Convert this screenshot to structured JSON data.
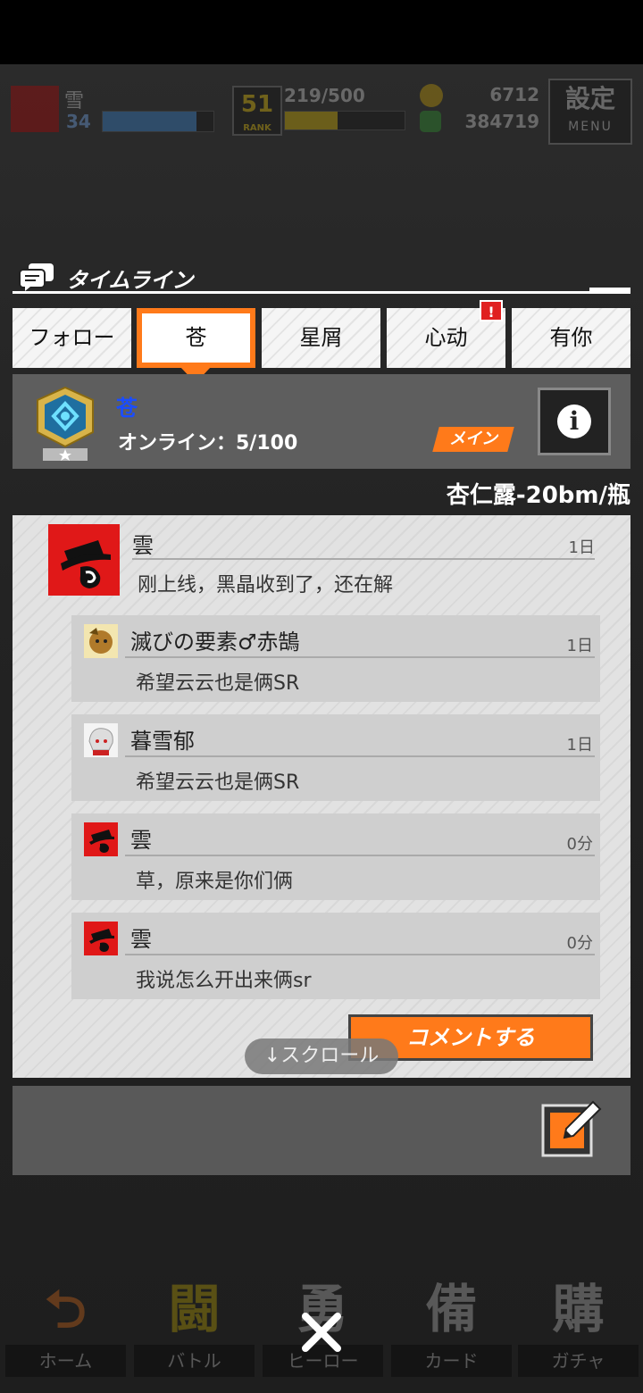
{
  "header": {
    "player_name": "雪",
    "player_level": "34",
    "player_level_progress": 0.85,
    "rank": "51",
    "rank_label": "RANK",
    "stamina": "219/500",
    "stamina_progress": 0.44,
    "coins": "6712",
    "gems": "384719",
    "menu_kanji": "設定",
    "menu_label": "MENU"
  },
  "timeline": {
    "title": "タイムライン",
    "tabs": [
      {
        "label": "フォロー"
      },
      {
        "label": "苍"
      },
      {
        "label": "星屑"
      },
      {
        "label": "心动"
      },
      {
        "label": "有你"
      }
    ],
    "alert_mark": "!"
  },
  "group": {
    "name": "苍",
    "online": "オンライン：5/100",
    "main_tag": "メイン"
  },
  "pinned_text": "杏仁露-20bm/瓶",
  "post": {
    "name": "雲",
    "time": "1日",
    "text": "刚上线，黑晶收到了，还在解"
  },
  "replies": [
    {
      "name": "滅びの要素♂赤鵠",
      "time": "1日",
      "text": "希望云云也是俩SR"
    },
    {
      "name": "暮雪郁",
      "time": "1日",
      "text": "希望云云也是俩SR"
    },
    {
      "name": "雲",
      "time": "0分",
      "text": "草，原来是你们俩"
    },
    {
      "name": "雲",
      "time": "0分",
      "text": "我说怎么开出来俩sr"
    }
  ],
  "comment_button": "コメントする",
  "scroll_hint": "↓スクロール",
  "bottom_nav": [
    {
      "icon_char": "⮌",
      "label": "ホーム"
    },
    {
      "icon_char": "闘",
      "label": "バトル"
    },
    {
      "icon_char": "勇",
      "label": "ヒーロー"
    },
    {
      "icon_char": "備",
      "label": "カード"
    },
    {
      "icon_char": "購",
      "label": "ガチャ"
    }
  ],
  "colors": {
    "accent": "#ff7a1a",
    "group_name": "#1a4dff",
    "avatar_red": "#e01818"
  }
}
